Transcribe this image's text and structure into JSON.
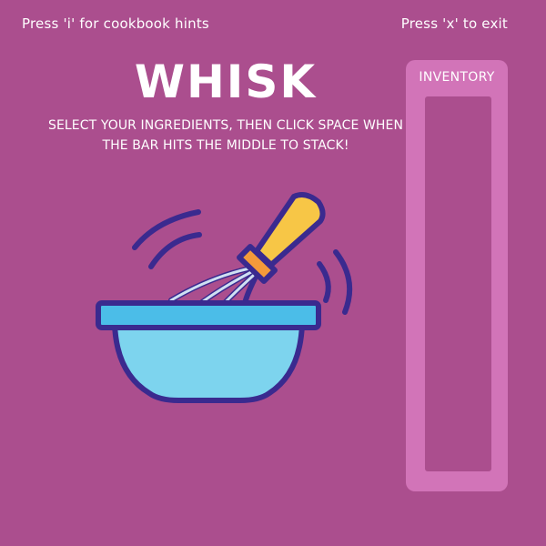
{
  "hints": {
    "cookbook": "Press 'i' for cookbook hints",
    "exit": "Press 'x' to exit"
  },
  "title": "WHISK",
  "instructions": "SELECT YOUR INGREDIENTS, THEN CLICK SPACE WHEN THE BAR HITS THE MIDDLE TO STACK!",
  "inventory": {
    "label": "INVENTORY",
    "items": []
  },
  "colors": {
    "background": "#ab4e8e",
    "inventory_panel": "#d274b8",
    "outline": "#3a2a8f",
    "bowl_fill": "#7dd4ee",
    "bowl_rim": "#4bbde8",
    "handle": "#f7c646",
    "collar": "#f49a3a"
  },
  "illustration": "whisk-in-bowl-icon"
}
